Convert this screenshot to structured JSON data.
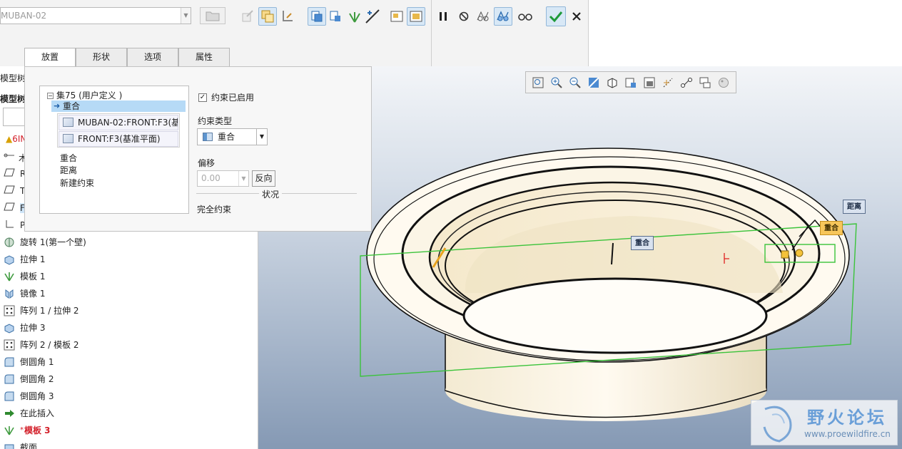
{
  "dashboard": {
    "ref_model": "MUBAN-02",
    "toolbar_icons": [
      "template-edit-icon",
      "assembly-copy-icon",
      "place-icon",
      "constraint-icon",
      "component-icon",
      "pattern-icon",
      "flip-icon",
      "window-icon",
      "window-large-icon"
    ],
    "pause_icon": "pause-icon",
    "preview_icons": [
      "no-preview-icon",
      "glasses-outline-icon",
      "verify-icon",
      "glasses-icon"
    ],
    "ok_icon": "check-icon",
    "cancel_icon": "close-icon"
  },
  "tabs": [
    {
      "label": "放置",
      "active": true
    },
    {
      "label": "形状",
      "active": false
    },
    {
      "label": "选项",
      "active": false
    },
    {
      "label": "属性",
      "active": false
    }
  ],
  "placement": {
    "set_label": "集75 (用户定义 )",
    "selected_constraint": "重合",
    "refs": [
      "MUBAN-02:FRONT:F3(基",
      "FRONT:F3(基准平面)"
    ],
    "options": [
      "重合",
      "距离",
      "新建约束"
    ],
    "enabled_label": "约束已启用",
    "constraint_type_label": "约束类型",
    "constraint_type_value": "重合",
    "offset_label": "偏移",
    "offset_value": "0.00",
    "flip_label": "反向",
    "status_label": "状况",
    "status_value": "完全约束"
  },
  "model_tree": {
    "partial_labels": [
      "模型树",
      "模型树",
      "6IN",
      "木",
      "R",
      "T",
      "F",
      "P"
    ],
    "items": [
      {
        "label": "旋转 1(第一个壁)",
        "icon": "revolve-icon",
        "new": false
      },
      {
        "label": "拉伸 1",
        "icon": "extrude-icon",
        "new": false
      },
      {
        "label": "模板 1",
        "icon": "template-icon",
        "new": false
      },
      {
        "label": "镜像 1",
        "icon": "mirror-icon",
        "new": false
      },
      {
        "label": "阵列 1 / 拉伸 2",
        "icon": "pattern-icon",
        "new": false
      },
      {
        "label": "拉伸 3",
        "icon": "extrude-icon",
        "new": false
      },
      {
        "label": "阵列 2 / 模板 2",
        "icon": "pattern-icon",
        "new": false
      },
      {
        "label": "倒圆角 1",
        "icon": "round-icon",
        "new": false
      },
      {
        "label": "倒圆角 2",
        "icon": "round-icon",
        "new": false
      },
      {
        "label": "倒圆角 3",
        "icon": "round-icon",
        "new": false
      },
      {
        "label": "在此插入",
        "icon": "insert-here-icon",
        "new": false
      },
      {
        "label": "模板 3",
        "icon": "template-icon",
        "new": true
      },
      {
        "label": "截面",
        "icon": "section-icon",
        "new": false
      }
    ]
  },
  "viewport": {
    "view_tools": [
      "refit-icon",
      "zoom-in-icon",
      "zoom-out-icon",
      "repaint-icon",
      "shading-icon",
      "saved-views-icon",
      "view-manager-icon",
      "datum-display-icon",
      "spin-center-icon",
      "annotation-display-icon",
      "appearance-icon"
    ],
    "annotations": [
      "重合",
      "距离",
      "重合"
    ]
  },
  "watermark": {
    "title": "野火论坛",
    "url": "www.proewildfire.cn"
  }
}
